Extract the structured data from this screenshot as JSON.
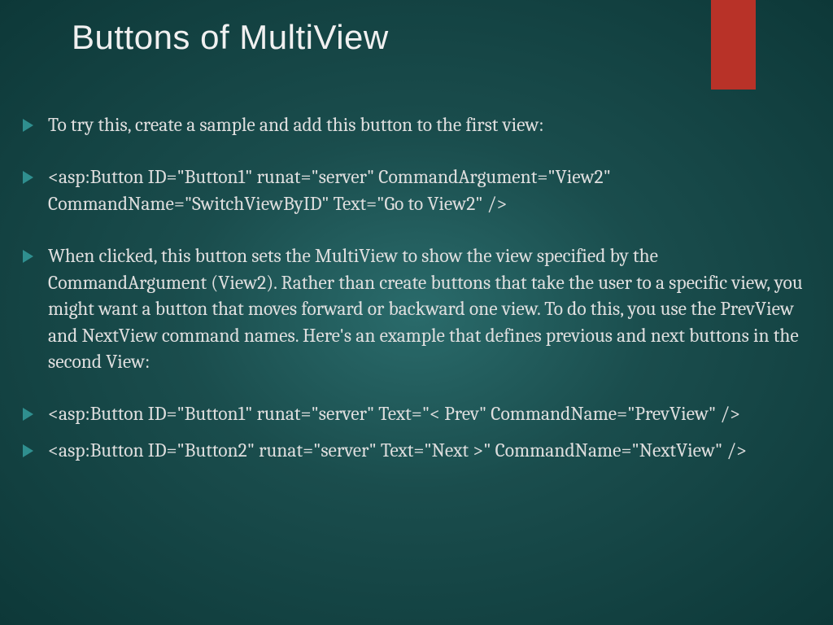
{
  "title": "Buttons of MultiView",
  "bullets": [
    {
      "text": "To try this, create a sample and add this button to the first view:",
      "spacing": "wide"
    },
    {
      "text": "<asp:Button ID=\"Button1\" runat=\"server\" CommandArgument=\"View2\" CommandName=\"SwitchViewByID\" Text=\"Go to View2\" />",
      "spacing": "wide"
    },
    {
      "text": "When clicked, this button sets the MultiView to show the view specified by the CommandArgument (View2). Rather than create buttons that take the user to a specific view, you might want a button that moves forward or backward one view. To do this, you use the PrevView and NextView command names. Here's an example that defines previous and next buttons in the second View:",
      "spacing": "wide"
    },
    {
      "text": "<asp:Button ID=\"Button1\" runat=\"server\" Text=\"< Prev\" CommandName=\"PrevView\" />",
      "spacing": "tight"
    },
    {
      "text": "<asp:Button ID=\"Button2\" runat=\"server\" Text=\"Next >\" CommandName=\"NextView\" />",
      "spacing": "tight"
    }
  ],
  "colors": {
    "accent": "#2f8f8f",
    "ribbon": "#b83228",
    "text": "#dedede",
    "title": "#f0f0f0"
  }
}
